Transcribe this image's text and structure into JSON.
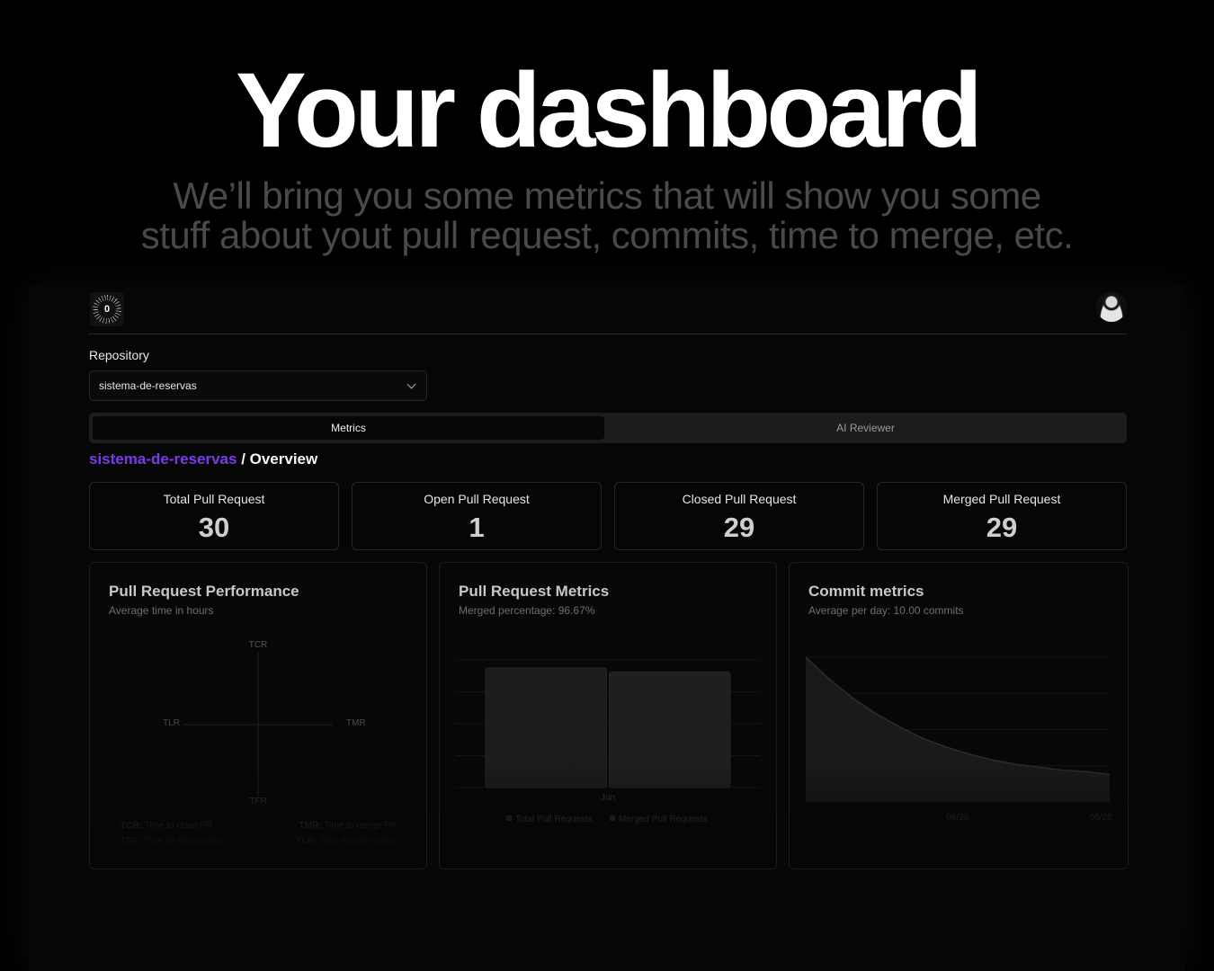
{
  "hero": {
    "title": "Your dashboard",
    "subtitle_line1": "We’ll bring you some metrics that will show you some",
    "subtitle_line2": "stuff about yout pull request, commits, time to merge, etc."
  },
  "header": {
    "logo_text": "0"
  },
  "repository": {
    "label": "Repository",
    "selected": "sistema-de-reservas"
  },
  "tabs": [
    {
      "label": "Metrics",
      "active": true
    },
    {
      "label": "AI Reviewer",
      "active": false
    }
  ],
  "breadcrumb": {
    "repo": "sistema-de-reservas",
    "page": "/ Overview"
  },
  "stats": [
    {
      "label": "Total Pull Request",
      "value": "30"
    },
    {
      "label": "Open Pull Request",
      "value": "1"
    },
    {
      "label": "Closed Pull Request",
      "value": "29"
    },
    {
      "label": "Merged Pull Request",
      "value": "29"
    }
  ],
  "performance": {
    "title": "Pull Request Performance",
    "subtitle": "Average time in hours",
    "axes": {
      "top": "TCR",
      "right": "TMR",
      "bottom": "TFR",
      "left": "TLR"
    },
    "legend": [
      {
        "abbr": "TCR:",
        "text": "Time to close PR"
      },
      {
        "abbr": "TMR:",
        "text": "Time to merge PR"
      },
      {
        "abbr": "TFR:",
        "text": "Time for first review"
      },
      {
        "abbr": "TLR:",
        "text": "Time for last review"
      }
    ]
  },
  "pr_metrics": {
    "title": "Pull Request Metrics",
    "subtitle": "Merged percentage: 96.67%"
  },
  "commit_metrics": {
    "title": "Commit metrics",
    "subtitle": "Average per day: 10.00 commits"
  },
  "chart_data": [
    {
      "type": "bar",
      "categories": [
        "Jun"
      ],
      "series": [
        {
          "name": "Total Pull Requests",
          "values": [
            30
          ]
        },
        {
          "name": "Merged Pull Requests",
          "values": [
            29
          ]
        }
      ],
      "ylim": [
        0,
        32
      ],
      "legend": "bottom",
      "colors": [
        "#1c1c1c",
        "#1f1f1f"
      ]
    },
    {
      "type": "area",
      "x": [
        "06/26",
        "06/28"
      ],
      "tick_labels": [
        "06/26",
        "06/28"
      ],
      "values": [
        10,
        8.5,
        7.2,
        6.1,
        5.2,
        4.4,
        3.8,
        3.3,
        2.9,
        2.6,
        2.4,
        2.2,
        2.1,
        1.9
      ],
      "grid": true,
      "colors": [
        "#1a1a1a"
      ]
    }
  ]
}
